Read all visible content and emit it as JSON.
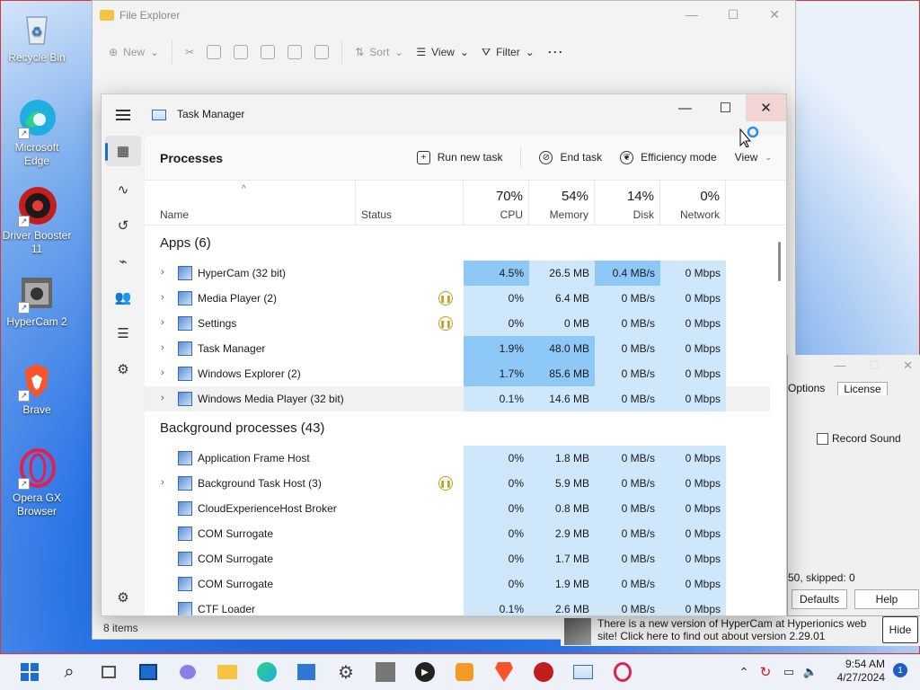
{
  "desktop": {
    "icons": [
      {
        "name": "recycle-bin",
        "label": "Recycle Bin"
      },
      {
        "name": "microsoft-edge",
        "label": "Microsoft Edge"
      },
      {
        "name": "driver-booster",
        "label": "Driver Booster 11"
      },
      {
        "name": "hypercam",
        "label": "HyperCam 2"
      },
      {
        "name": "brave",
        "label": "Brave"
      },
      {
        "name": "opera-gx",
        "label": "Opera GX Browser"
      }
    ]
  },
  "file_explorer": {
    "title": "File Explorer",
    "toolbar": {
      "new": "New",
      "sort": "Sort",
      "view": "View",
      "filter": "Filter",
      "more": "⋯"
    },
    "status": "8 items"
  },
  "hypercam": {
    "menu": [
      "Options",
      "License"
    ],
    "record_sound": "Record Sound",
    "stats": "50, skipped: 0",
    "defaults": "Defaults",
    "help": "Help",
    "notice": "There is a new version of HyperCam at Hyperionics web site! Click here to find out about version 2.29.01",
    "hide": "Hide"
  },
  "task_manager": {
    "title": "Task Manager",
    "page_title": "Processes",
    "actions": {
      "run_new_task": "Run new task",
      "end_task": "End task",
      "efficiency_mode": "Efficiency mode",
      "view": "View"
    },
    "columns": {
      "name": "Name",
      "status": "Status",
      "cpu": {
        "pct": "70%",
        "label": "CPU"
      },
      "memory": {
        "pct": "54%",
        "label": "Memory"
      },
      "disk": {
        "pct": "14%",
        "label": "Disk"
      },
      "network": {
        "pct": "0%",
        "label": "Network"
      }
    },
    "groups": {
      "apps": "Apps (6)",
      "background": "Background processes (43)"
    },
    "apps": [
      {
        "name": "HyperCam (32 bit)",
        "cpu": "4.5%",
        "memory": "26.5 MB",
        "disk": "0.4 MB/s",
        "network": "0 Mbps",
        "expand": true,
        "paused": false
      },
      {
        "name": "Media Player (2)",
        "cpu": "0%",
        "memory": "6.4 MB",
        "disk": "0 MB/s",
        "network": "0 Mbps",
        "expand": true,
        "paused": true
      },
      {
        "name": "Settings",
        "cpu": "0%",
        "memory": "0 MB",
        "disk": "0 MB/s",
        "network": "0 Mbps",
        "expand": true,
        "paused": true
      },
      {
        "name": "Task Manager",
        "cpu": "1.9%",
        "memory": "48.0 MB",
        "disk": "0 MB/s",
        "network": "0 Mbps",
        "expand": true,
        "paused": false
      },
      {
        "name": "Windows Explorer (2)",
        "cpu": "1.7%",
        "memory": "85.6 MB",
        "disk": "0 MB/s",
        "network": "0 Mbps",
        "expand": true,
        "paused": false
      },
      {
        "name": "Windows Media Player (32 bit)",
        "cpu": "0.1%",
        "memory": "14.6 MB",
        "disk": "0 MB/s",
        "network": "0 Mbps",
        "expand": true,
        "paused": false
      }
    ],
    "background": [
      {
        "name": "Application Frame Host",
        "cpu": "0%",
        "memory": "1.8 MB",
        "disk": "0 MB/s",
        "network": "0 Mbps",
        "expand": false,
        "paused": false
      },
      {
        "name": "Background Task Host (3)",
        "cpu": "0%",
        "memory": "5.9 MB",
        "disk": "0 MB/s",
        "network": "0 Mbps",
        "expand": true,
        "paused": true
      },
      {
        "name": "CloudExperienceHost Broker",
        "cpu": "0%",
        "memory": "0.8 MB",
        "disk": "0 MB/s",
        "network": "0 Mbps",
        "expand": false,
        "paused": false
      },
      {
        "name": "COM Surrogate",
        "cpu": "0%",
        "memory": "2.9 MB",
        "disk": "0 MB/s",
        "network": "0 Mbps",
        "expand": false,
        "paused": false
      },
      {
        "name": "COM Surrogate",
        "cpu": "0%",
        "memory": "1.7 MB",
        "disk": "0 MB/s",
        "network": "0 Mbps",
        "expand": false,
        "paused": false
      },
      {
        "name": "COM Surrogate",
        "cpu": "0%",
        "memory": "1.9 MB",
        "disk": "0 MB/s",
        "network": "0 Mbps",
        "expand": false,
        "paused": false
      },
      {
        "name": "CTF Loader",
        "cpu": "0.1%",
        "memory": "2.6 MB",
        "disk": "0 MB/s",
        "network": "0 Mbps",
        "expand": false,
        "paused": false
      }
    ]
  },
  "taskbar": {
    "time": "9:54 AM",
    "date": "4/27/2024",
    "notifications": "1"
  },
  "colors": {
    "heat_light": "#cfe7fb",
    "heat_mid": "#a9d5f7",
    "heat_strong": "#8ec8f6",
    "accent": "#1d6ccf"
  }
}
